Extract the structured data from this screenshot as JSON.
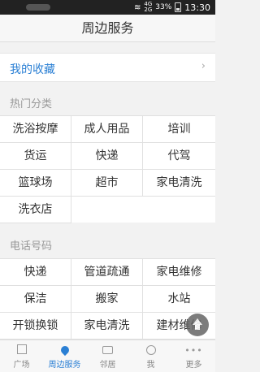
{
  "status_bar": {
    "network": "4G",
    "network2": "2G",
    "battery": "33%",
    "time": "13:30"
  },
  "header": {
    "title": "周边服务"
  },
  "favorites": {
    "label": "我的收藏",
    "arrow": "›"
  },
  "hot_categories": {
    "title": "热门分类",
    "items": [
      "洗浴按摩",
      "成人用品",
      "培训",
      "货运",
      "快递",
      "代驾",
      "篮球场",
      "超市",
      "家电清洗",
      "洗衣店"
    ]
  },
  "phone_numbers": {
    "title": "电话号码",
    "items": [
      "快递",
      "管道疏通",
      "家电维修",
      "保洁",
      "搬家",
      "水站",
      "开锁换锁",
      "家电清洗",
      "建材维修"
    ]
  },
  "tabbar": {
    "tabs": [
      {
        "label": "广场",
        "icon": "cube-icon"
      },
      {
        "label": "周边服务",
        "icon": "location-pin-icon",
        "active": true
      },
      {
        "label": "邻居",
        "icon": "chat-icon"
      },
      {
        "label": "我",
        "icon": "person-icon"
      },
      {
        "label": "更多",
        "icon": "more-dots-icon"
      }
    ]
  },
  "colors": {
    "accent": "#2a7fd4",
    "background": "#f2f2f2"
  }
}
